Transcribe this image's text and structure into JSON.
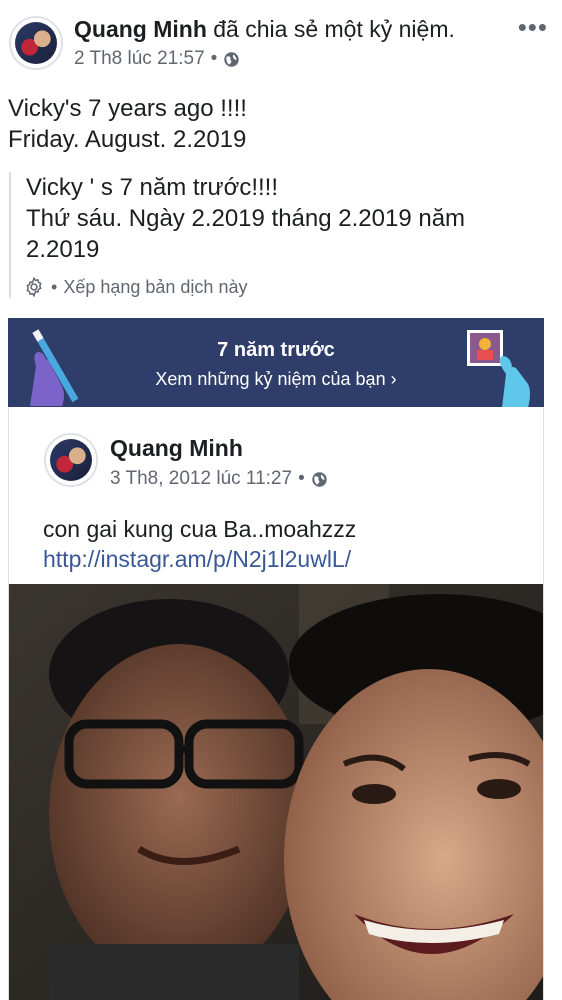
{
  "header": {
    "author": "Quang Minh",
    "action": " đã chia sẻ một kỷ niệm.",
    "timestamp": "2 Th8 lúc 21:57",
    "separator": "•",
    "more_label": "•••"
  },
  "post": {
    "text": "Vicky's 7 years ago  !!!!\nFriday. August. 2.2019"
  },
  "translation": {
    "text": "Vicky ' s 7 năm trước!!!!\nThứ sáu. Ngày 2.2019 tháng 2.2019 năm\n2.2019",
    "rate_label": "Xếp hạng bản dịch này",
    "separator": "•"
  },
  "memory_banner": {
    "title": "7 năm trước",
    "subtitle": "Xem những kỷ niệm của bạn ›",
    "background": "#2f3d6b"
  },
  "shared_post": {
    "author": "Quang Minh",
    "timestamp": "3 Th8, 2012 lúc 11:27",
    "separator": "•",
    "text": "con gai kung cua Ba..moahzzz",
    "link": "http://instagr.am/p/N2j1l2uwlL/"
  },
  "icons": {
    "globe": "globe-icon",
    "gear": "gear-icon",
    "more": "more-options-icon"
  },
  "colors": {
    "link": "#385898",
    "meta": "#606770",
    "banner": "#2f3d6b"
  }
}
